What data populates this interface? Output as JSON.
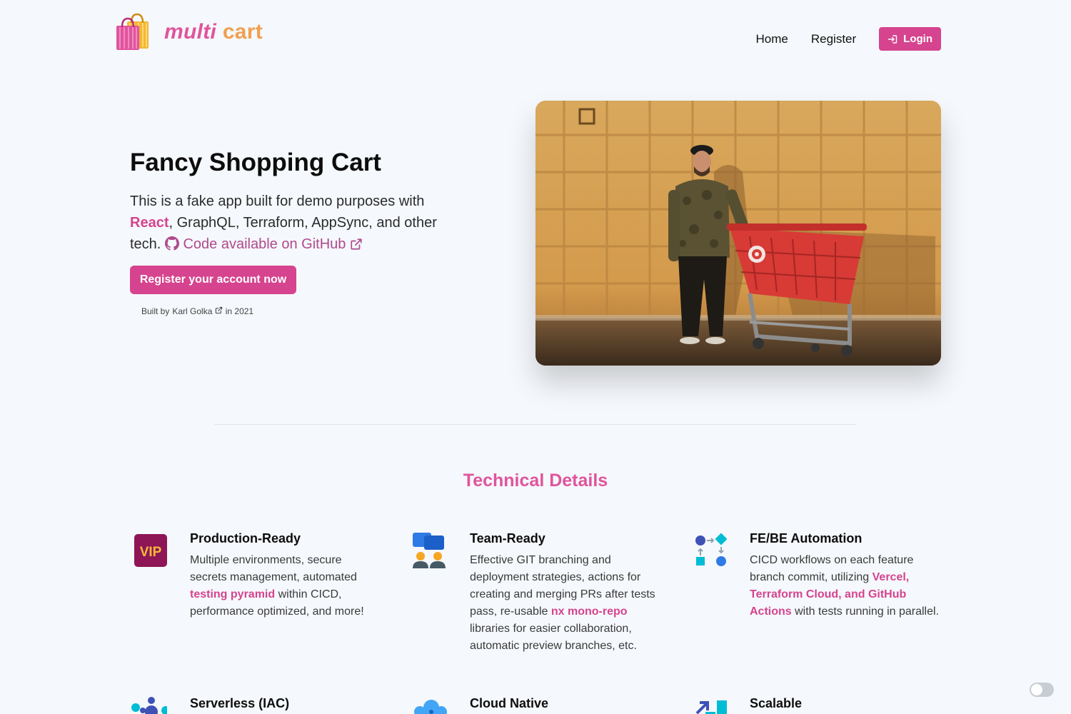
{
  "header": {
    "logo": {
      "word1": "multi",
      "word2": "cart"
    },
    "nav": {
      "home": "Home",
      "register": "Register",
      "login": "Login"
    }
  },
  "hero": {
    "title": "Fancy Shopping Cart",
    "desc_prefix": "This is a fake app built for demo purposes with ",
    "desc_react": "React",
    "desc_middle": ", GraphQL, Terraform, AppSync, and other tech.",
    "github_link": "Code available on GitHub",
    "cta": "Register your account now",
    "built_prefix": "Built by",
    "built_author": "Karl Golka",
    "built_suffix": "in 2021"
  },
  "technical": {
    "title": "Technical Details",
    "features": [
      {
        "icon": "vip-icon",
        "title": "Production-Ready",
        "desc_a": "Multiple environments, secure secrets management, automated ",
        "highlight": "testing pyramid",
        "desc_b": " within CICD, performance optimized, and more!"
      },
      {
        "icon": "team-icon",
        "title": "Team-Ready",
        "desc_a": "Effective GIT branching and deployment strategies, actions for creating and merging PRs after tests pass, re-usable ",
        "highlight": "nx mono-repo",
        "desc_b": " libraries for easier collaboration, automatic preview branches, etc."
      },
      {
        "icon": "workflow-icon",
        "title": "FE/BE Automation",
        "desc_a": "CICD workflows on each feature branch commit, utilizing ",
        "highlight": "Vercel, Terraform Cloud, and GitHub Actions",
        "desc_b": " with tests running in parallel."
      },
      {
        "icon": "network-icon",
        "title": "Serverless (IAC)"
      },
      {
        "icon": "cloud-icon",
        "title": "Cloud Native"
      },
      {
        "icon": "scale-icon",
        "title": "Scalable"
      }
    ]
  },
  "colors": {
    "accent": "#d6438e",
    "accent_light": "#e0549e",
    "logo_orange": "#f0a050",
    "background": "#f5f8fc"
  }
}
